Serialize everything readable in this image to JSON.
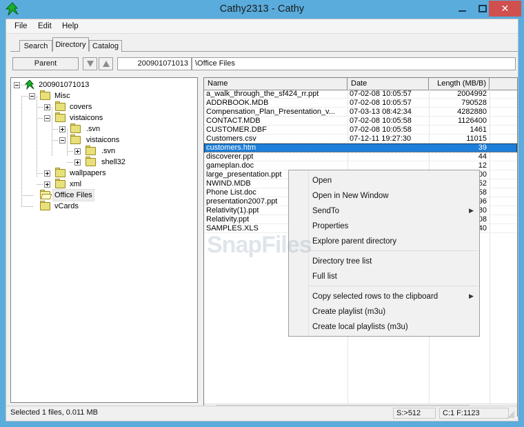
{
  "window": {
    "title": "Cathy2313 - Cathy",
    "app_icon": "cathy-green-arrow-icon",
    "controls": {
      "minimize": "–",
      "maximize": "❑",
      "close": "×"
    },
    "close_color": "#d0504f",
    "titlebar_color": "#5aacdc"
  },
  "menubar": {
    "items": [
      "File",
      "Edit",
      "Help"
    ]
  },
  "tabs": {
    "items": [
      {
        "label": "Search",
        "active": false
      },
      {
        "label": "Directory",
        "active": true
      },
      {
        "label": "Catalog",
        "active": false
      }
    ]
  },
  "toolbar": {
    "parent_label": "Parent",
    "down_icon": "arrow-down-icon",
    "up_icon": "arrow-up-icon",
    "volume_value": "200901071013",
    "path_value": "\\Office Files"
  },
  "tree": {
    "nodes": [
      {
        "label": "200901071013",
        "depth": 0,
        "toggle": "minus",
        "icon": "cathy-root-icon",
        "selected": false
      },
      {
        "label": "Misc",
        "depth": 1,
        "toggle": "minus",
        "icon": "folder-closed-icon",
        "selected": false
      },
      {
        "label": "covers",
        "depth": 2,
        "toggle": "plus",
        "icon": "folder-closed-icon",
        "selected": false
      },
      {
        "label": "vistaicons",
        "depth": 2,
        "toggle": "minus",
        "icon": "folder-closed-icon",
        "selected": false
      },
      {
        "label": ".svn",
        "depth": 3,
        "toggle": "plus",
        "icon": "folder-closed-icon",
        "selected": false
      },
      {
        "label": "vistaicons",
        "depth": 3,
        "toggle": "minus",
        "icon": "folder-closed-icon",
        "selected": false
      },
      {
        "label": ".svn",
        "depth": 4,
        "toggle": "plus",
        "icon": "folder-closed-icon",
        "selected": false
      },
      {
        "label": "shell32",
        "depth": 4,
        "toggle": "plus",
        "icon": "folder-closed-icon",
        "selected": false
      },
      {
        "label": "wallpapers",
        "depth": 2,
        "toggle": "plus",
        "icon": "folder-closed-icon",
        "selected": false
      },
      {
        "label": "xml",
        "depth": 2,
        "toggle": "plus",
        "icon": "folder-closed-icon",
        "selected": false
      },
      {
        "label": "Office Files",
        "depth": 1,
        "toggle": "none",
        "icon": "folder-open-icon",
        "selected": true
      },
      {
        "label": "vCards",
        "depth": 1,
        "toggle": "none",
        "icon": "folder-closed-icon",
        "selected": false
      }
    ]
  },
  "filelist": {
    "columns": [
      "Name",
      "Date",
      "Length (MB/B)",
      ""
    ],
    "rows": [
      {
        "name": "a_walk_through_the_sf424_rr.ppt",
        "date": "07-02-08 10:05:57",
        "length": "2004992",
        "selected": false
      },
      {
        "name": "ADDRBOOK.MDB",
        "date": "07-02-08 10:05:57",
        "length": "790528",
        "selected": false
      },
      {
        "name": "Compensation_Plan_Presentation_v...",
        "date": "07-03-13 08:42:34",
        "length": "4282880",
        "selected": false
      },
      {
        "name": "CONTACT.MDB",
        "date": "07-02-08 10:05:58",
        "length": "1126400",
        "selected": false
      },
      {
        "name": "CUSTOMER.DBF",
        "date": "07-02-08 10:05:58",
        "length": "1461",
        "selected": false
      },
      {
        "name": "Customers.csv",
        "date": "07-12-11 19:27:30",
        "length": "11015",
        "selected": false
      },
      {
        "name": "customers.htm",
        "date": "",
        "length": "39",
        "selected": true
      },
      {
        "name": "discoverer.ppt",
        "date": "",
        "length": "44",
        "selected": false
      },
      {
        "name": "gameplan.doc",
        "date": "",
        "length": "12",
        "selected": false
      },
      {
        "name": "large_presentation.ppt",
        "date": "",
        "length": "00",
        "selected": false
      },
      {
        "name": "NWIND.MDB",
        "date": "",
        "length": "52",
        "selected": false
      },
      {
        "name": "Phone List.doc",
        "date": "",
        "length": "58",
        "selected": false
      },
      {
        "name": "presentation2007.ppt",
        "date": "",
        "length": "96",
        "selected": false
      },
      {
        "name": "Relativity(1).ppt",
        "date": "",
        "length": "80",
        "selected": false
      },
      {
        "name": "Relativity.ppt",
        "date": "",
        "length": "08",
        "selected": false
      },
      {
        "name": "SAMPLES.XLS",
        "date": "",
        "length": "40",
        "selected": false
      }
    ],
    "hscroll": {
      "left_icon": "chevron-left-icon",
      "right_icon": "chevron-right-icon"
    }
  },
  "context_menu": {
    "items": [
      {
        "label": "Open",
        "submenu": false,
        "sep_after": false
      },
      {
        "label": "Open in New Window",
        "submenu": false,
        "sep_after": false
      },
      {
        "label": "SendTo",
        "submenu": true,
        "sep_after": false
      },
      {
        "label": "Properties",
        "submenu": false,
        "sep_after": false
      },
      {
        "label": "Explore parent directory",
        "submenu": false,
        "sep_after": true
      },
      {
        "label": "Directory tree list",
        "submenu": false,
        "sep_after": false
      },
      {
        "label": "Full list",
        "submenu": false,
        "sep_after": true
      },
      {
        "label": "Copy selected rows to the clipboard",
        "submenu": true,
        "sep_after": false
      },
      {
        "label": "Create playlist (m3u)",
        "submenu": false,
        "sep_after": false
      },
      {
        "label": "Create local playlists (m3u)",
        "submenu": false,
        "sep_after": false
      }
    ],
    "submenu_arrow": "▶"
  },
  "statusbar": {
    "main": "Selected 1 files, 0.011 MB",
    "cell_s": "S:>512",
    "cell_cf": "C:1 F:1123",
    "grip_icon": "resize-grip-icon"
  },
  "watermark": {
    "text": "SnapFiles"
  }
}
